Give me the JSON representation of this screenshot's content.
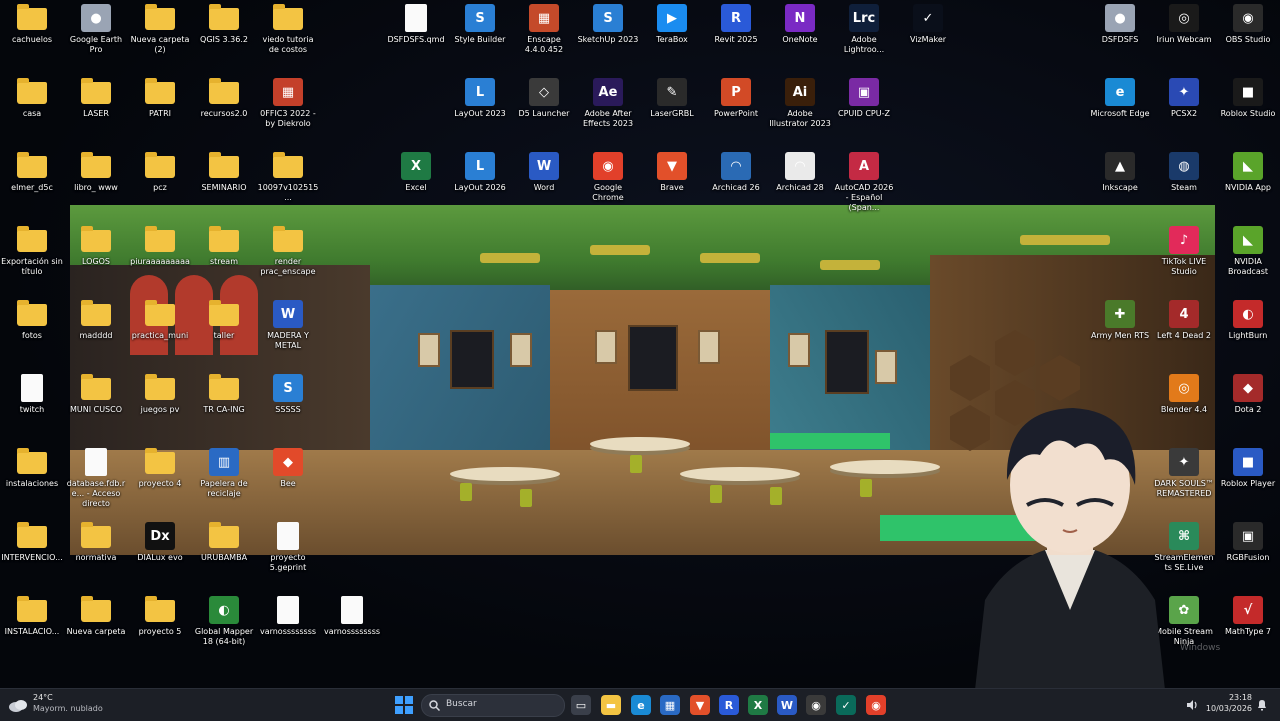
{
  "desktop": {
    "icons": [
      {
        "label": "cachuelos",
        "type": "folder"
      },
      {
        "label": "Google Earth Pro",
        "type": "app",
        "glyph": "●",
        "color": "#9aa4b4"
      },
      {
        "label": "Nueva carpeta (2)",
        "type": "folder"
      },
      {
        "label": "QGIS 3.36.2",
        "type": "folder"
      },
      {
        "label": "viedo tutoria de costos",
        "type": "folder"
      },
      {
        "label": "DSFDSFS.qmd",
        "type": "doc"
      },
      {
        "label": "Style Builder",
        "type": "app",
        "glyph": "S",
        "color": "#2a7fd4"
      },
      {
        "label": "Enscape 4.4.0.452",
        "type": "app",
        "glyph": "▦",
        "color": "#c44a2a"
      },
      {
        "label": "SketchUp 2023",
        "type": "app",
        "glyph": "S",
        "color": "#2a7fd4"
      },
      {
        "label": "TeraBox",
        "type": "app",
        "glyph": "▶",
        "color": "#1a8cf0"
      },
      {
        "label": "Revit 2025",
        "type": "app",
        "glyph": "R",
        "color": "#2a5ad8"
      },
      {
        "label": "OneNote",
        "type": "app",
        "glyph": "N",
        "color": "#7a2ac4"
      },
      {
        "label": "Adobe Lightroo...",
        "type": "app",
        "glyph": "Lrc",
        "color": "#0f1f3a"
      },
      {
        "label": "VizMaker",
        "type": "app",
        "glyph": "✓",
        "color": "#0a0f1a"
      },
      {
        "label": "DSFDSFS",
        "type": "app",
        "glyph": "●",
        "color": "#9aa4b4"
      },
      {
        "label": "Iriun Webcam",
        "type": "app",
        "glyph": "◎",
        "color": "#1a1a1a"
      },
      {
        "label": "OBS Studio",
        "type": "app",
        "glyph": "◉",
        "color": "#2a2a2a"
      },
      {
        "label": "casa",
        "type": "folder"
      },
      {
        "label": "LASER",
        "type": "folder"
      },
      {
        "label": "PATRI",
        "type": "folder"
      },
      {
        "label": "recursos2.0",
        "type": "folder"
      },
      {
        "label": "0FFIC3 2022 - by Diekrolo",
        "type": "app",
        "glyph": "▦",
        "color": "#c4402a"
      },
      {
        "label": "LayOut 2023",
        "type": "app",
        "glyph": "L",
        "color": "#2a7fd4"
      },
      {
        "label": "D5 Launcher",
        "type": "app",
        "glyph": "◇",
        "color": "#3a3a3a"
      },
      {
        "label": "Adobe After Effects 2023",
        "type": "app",
        "glyph": "Ae",
        "color": "#2a1a5a"
      },
      {
        "label": "LaserGRBL",
        "type": "app",
        "glyph": "✎",
        "color": "#2a2a2a"
      },
      {
        "label": "PowerPoint",
        "type": "app",
        "glyph": "P",
        "color": "#d24a26"
      },
      {
        "label": "Adobe Illustrator 2023",
        "type": "app",
        "glyph": "Ai",
        "color": "#3a1f0a"
      },
      {
        "label": "CPUID CPU-Z",
        "type": "app",
        "glyph": "▣",
        "color": "#7a2aa4"
      },
      {
        "label": "Microsoft Edge",
        "type": "app",
        "glyph": "e",
        "color": "#1a8ad4"
      },
      {
        "label": "PCSX2",
        "type": "app",
        "glyph": "✦",
        "color": "#2a4ab4"
      },
      {
        "label": "Roblox Studio",
        "type": "app",
        "glyph": "■",
        "color": "#1a1a1a"
      },
      {
        "label": "elmer_d5c",
        "type": "folder"
      },
      {
        "label": "libro_ www",
        "type": "folder"
      },
      {
        "label": "pcz",
        "type": "folder"
      },
      {
        "label": "SEMINARIO",
        "type": "folder"
      },
      {
        "label": "10097v102515...",
        "type": "folder"
      },
      {
        "label": "Excel",
        "type": "app",
        "glyph": "X",
        "color": "#1f7a44"
      },
      {
        "label": "LayOut 2026",
        "type": "app",
        "glyph": "L",
        "color": "#2a7fd4"
      },
      {
        "label": "Word",
        "type": "app",
        "glyph": "W",
        "color": "#2a5ac4"
      },
      {
        "label": "Google Chrome",
        "type": "app",
        "glyph": "◉",
        "color": "#e2402a"
      },
      {
        "label": "Brave",
        "type": "app",
        "glyph": "▼",
        "color": "#e2502a"
      },
      {
        "label": "Archicad 26",
        "type": "app",
        "glyph": "◠",
        "color": "#2a6ab4"
      },
      {
        "label": "Archicad 28",
        "type": "app",
        "glyph": "◠",
        "color": "#eaeaea"
      },
      {
        "label": "AutoCAD 2026 - Español (Span...",
        "type": "app",
        "glyph": "A",
        "color": "#c42a44"
      },
      {
        "label": "Inkscape",
        "type": "app",
        "glyph": "▲",
        "color": "#2a2a2a"
      },
      {
        "label": "Steam",
        "type": "app",
        "glyph": "◍",
        "color": "#1a3a6a"
      },
      {
        "label": "NVIDIA App",
        "type": "app",
        "glyph": "◣",
        "color": "#5aa42a"
      },
      {
        "label": "Exportación sin título",
        "type": "folder"
      },
      {
        "label": "LOGOS",
        "type": "folder"
      },
      {
        "label": "piuraaaaaaaaa",
        "type": "folder"
      },
      {
        "label": "stream",
        "type": "folder"
      },
      {
        "label": "render prac_enscape",
        "type": "folder"
      },
      {
        "label": "TikTok LIVE Studio",
        "type": "app",
        "glyph": "♪",
        "color": "#e22a5a"
      },
      {
        "label": "NVIDIA Broadcast",
        "type": "app",
        "glyph": "◣",
        "color": "#5aa42a"
      },
      {
        "label": "fotos",
        "type": "folder"
      },
      {
        "label": "madddd",
        "type": "folder"
      },
      {
        "label": "practica_muni",
        "type": "folder"
      },
      {
        "label": "taller",
        "type": "folder"
      },
      {
        "label": "MADERA Y METAL",
        "type": "app",
        "glyph": "W",
        "color": "#2a5ac4"
      },
      {
        "label": "Army Men RTS",
        "type": "app",
        "glyph": "✚",
        "color": "#4a7a2a"
      },
      {
        "label": "Left 4 Dead 2",
        "type": "app",
        "glyph": "4",
        "color": "#a42a2a"
      },
      {
        "label": "LightBurn",
        "type": "app",
        "glyph": "◐",
        "color": "#c42a2a"
      },
      {
        "label": "twitch",
        "type": "doc"
      },
      {
        "label": "MUNI CUSCO",
        "type": "folder"
      },
      {
        "label": "juegos pv",
        "type": "folder"
      },
      {
        "label": "TR CA-ING",
        "type": "folder"
      },
      {
        "label": "SSSSS",
        "type": "app",
        "glyph": "S",
        "color": "#2a7fd4"
      },
      {
        "label": "Blender 4.4",
        "type": "app",
        "glyph": "◎",
        "color": "#e27a1a"
      },
      {
        "label": "Dota 2",
        "type": "app",
        "glyph": "◆",
        "color": "#a42a2a"
      },
      {
        "label": "instalaciones",
        "type": "folder"
      },
      {
        "label": "database.fdb.re... - Acceso directo",
        "type": "doc"
      },
      {
        "label": "proyecto 4",
        "type": "folder"
      },
      {
        "label": "Papelera de reciclaje",
        "type": "app",
        "glyph": "▥",
        "color": "#2a6ac4"
      },
      {
        "label": "Bee",
        "type": "app",
        "glyph": "◆",
        "color": "#e24a2a"
      },
      {
        "label": "DARK SOULS™ REMASTERED",
        "type": "app",
        "glyph": "✦",
        "color": "#3a3a3a"
      },
      {
        "label": "Roblox Player",
        "type": "app",
        "glyph": "■",
        "color": "#2a5ac4"
      },
      {
        "label": "INTERVENCIO...",
        "type": "folder"
      },
      {
        "label": "normativa",
        "type": "folder"
      },
      {
        "label": "DIALux evo",
        "type": "app",
        "glyph": "Dx",
        "color": "#111111"
      },
      {
        "label": "URUBAMBA",
        "type": "folder"
      },
      {
        "label": "proyecto 5.geprint",
        "type": "doc"
      },
      {
        "label": "StreamElements SE.Live",
        "type": "app",
        "glyph": "⌘",
        "color": "#2a8a5a"
      },
      {
        "label": "RGBFusion",
        "type": "app",
        "glyph": "▣",
        "color": "#2a2a2a"
      },
      {
        "label": "INSTALACIO...",
        "type": "folder"
      },
      {
        "label": "Nueva carpeta",
        "type": "folder"
      },
      {
        "label": "proyecto 5",
        "type": "folder"
      },
      {
        "label": "Global Mapper 18 (64-bit)",
        "type": "app",
        "glyph": "◐",
        "color": "#2a8a3a"
      },
      {
        "label": "varnossssssss",
        "type": "doc"
      },
      {
        "label": "varnossssssss",
        "type": "doc"
      },
      {
        "label": "Mobile Stream Ninja",
        "type": "app",
        "glyph": "✿",
        "color": "#5aa44a"
      },
      {
        "label": "MathType 7",
        "type": "app",
        "glyph": "√",
        "color": "#c42a2a"
      }
    ],
    "watermark": "Windows"
  },
  "taskbar": {
    "weather": {
      "temp": "24°C",
      "desc": "Mayorm. nublado",
      "icon": "cloud-icon"
    },
    "start": "windows-start-icon",
    "search": {
      "placeholder": "Buscar"
    },
    "pinned": [
      {
        "name": "task-view-icon",
        "glyph": "▭",
        "color": "#3a3f4a"
      },
      {
        "name": "file-explorer-icon",
        "glyph": "▬",
        "color": "#f3c443"
      },
      {
        "name": "edge-icon",
        "glyph": "e",
        "color": "#1a8ad4"
      },
      {
        "name": "store-icon",
        "glyph": "▦",
        "color": "#2a6ac4"
      },
      {
        "name": "brave-icon",
        "glyph": "▼",
        "color": "#e2502a"
      },
      {
        "name": "revit-icon",
        "glyph": "R",
        "color": "#2a5ad8"
      },
      {
        "name": "excel-icon",
        "glyph": "X",
        "color": "#1f7a44"
      },
      {
        "name": "word-icon",
        "glyph": "W",
        "color": "#2a5ac4"
      },
      {
        "name": "obs-icon",
        "glyph": "◉",
        "color": "#3a3a3a"
      },
      {
        "name": "vizmaker-icon",
        "glyph": "✓",
        "color": "#0a6a5a"
      },
      {
        "name": "chrome-icon",
        "glyph": "◉",
        "color": "#e2402a"
      }
    ],
    "clock": {
      "time": "23:18",
      "date": "10/03/2026"
    }
  }
}
